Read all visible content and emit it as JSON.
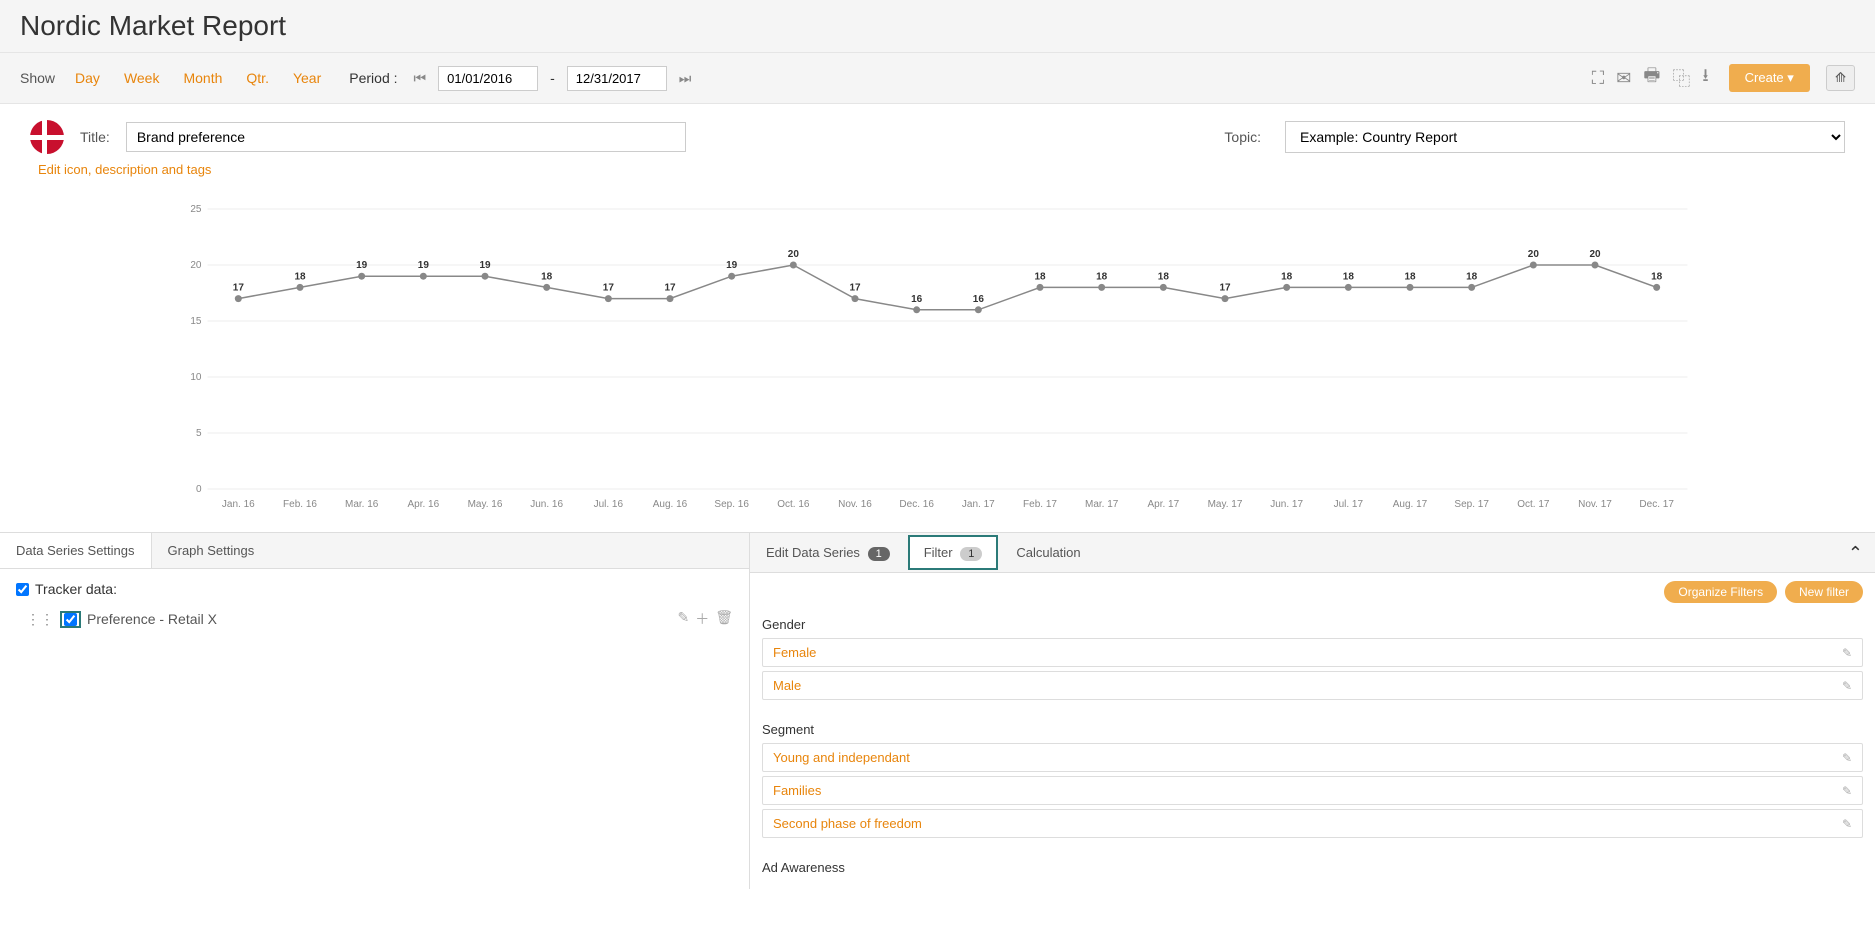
{
  "header": {
    "title": "Nordic Market Report"
  },
  "toolbar": {
    "show_label": "Show",
    "day": "Day",
    "week": "Week",
    "month": "Month",
    "qtr": "Qtr.",
    "year": "Year",
    "period_label": "Period :",
    "date_from": "01/01/2016",
    "date_to": "12/31/2017",
    "create_label": "Create"
  },
  "title_section": {
    "title_label": "Title:",
    "title_value": "Brand preference",
    "topic_label": "Topic:",
    "topic_value": "Example: Country Report",
    "edit_link": "Edit icon, description and tags"
  },
  "chart_data": {
    "type": "line",
    "ylim": [
      0,
      25
    ],
    "yticks": [
      0,
      5,
      10,
      15,
      20,
      25
    ],
    "categories": [
      "Jan. 16",
      "Feb. 16",
      "Mar. 16",
      "Apr. 16",
      "May. 16",
      "Jun. 16",
      "Jul. 16",
      "Aug. 16",
      "Sep. 16",
      "Oct. 16",
      "Nov. 16",
      "Dec. 16",
      "Jan. 17",
      "Feb. 17",
      "Mar. 17",
      "Apr. 17",
      "May. 17",
      "Jun. 17",
      "Jul. 17",
      "Aug. 17",
      "Sep. 17",
      "Oct. 17",
      "Nov. 17",
      "Dec. 17"
    ],
    "values": [
      17,
      18,
      19,
      19,
      19,
      18,
      17,
      17,
      19,
      20,
      17,
      16,
      16,
      18,
      18,
      18,
      17,
      18,
      18,
      18,
      18,
      20,
      20,
      18
    ],
    "title": "",
    "xlabel": "",
    "ylabel": ""
  },
  "left_panel": {
    "tabs": {
      "data_series": "Data Series Settings",
      "graph": "Graph Settings"
    },
    "tracker_label": "Tracker data:",
    "series_name": "Preference - Retail X"
  },
  "right_panel": {
    "tabs": {
      "edit_data_series": "Edit Data Series",
      "edit_data_series_badge": "1",
      "filter": "Filter",
      "filter_badge": "1",
      "calculation": "Calculation"
    },
    "organize_filters": "Organize Filters",
    "new_filter": "New filter",
    "groups": [
      {
        "title": "Gender",
        "items": [
          "Female",
          "Male"
        ]
      },
      {
        "title": "Segment",
        "items": [
          "Young and independant",
          "Families",
          "Second phase of freedom"
        ]
      },
      {
        "title": "Ad Awareness",
        "items": []
      }
    ]
  }
}
